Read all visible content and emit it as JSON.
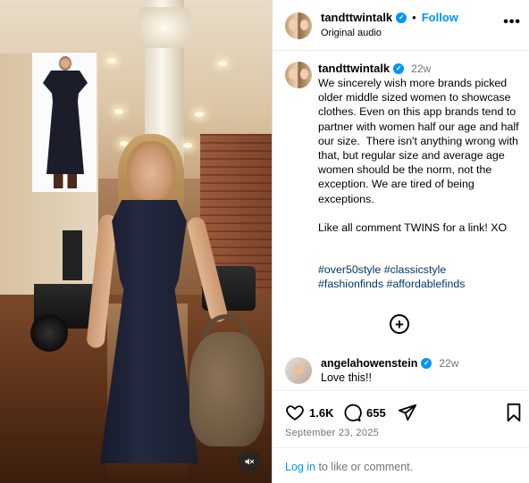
{
  "header": {
    "username": "tandttwintalk",
    "separator": "•",
    "follow_label": "Follow",
    "audio_label": "Original audio",
    "more_label": "•••"
  },
  "caption": {
    "username": "tandttwintalk",
    "time": "22w",
    "text": "We sincerely wish more brands picked older middle sized women to showcase clothes. Even on this app brands tend to partner with women half our age and half our size.  There isn't anything wrong with that, but regular size and average age women should be the norm, not the exception. We are tired of being exceptions.\n\nLike all comment TWINS for a link! XO",
    "hashtags": [
      "#over50style",
      "#classicstyle",
      "#fashionfinds",
      "#affordablefinds"
    ]
  },
  "load_more_icon": "plus-circle-icon",
  "comment": {
    "username": "angelahowenstein",
    "time": "22w",
    "text": "Love this!!"
  },
  "actions": {
    "likes": "1.6K",
    "comments": "655",
    "date": "September 23, 2025"
  },
  "login": {
    "link": "Log in",
    "rest": " to like or comment."
  },
  "media": {
    "mute_icon": "speaker-muted-icon"
  },
  "colors": {
    "accent": "#0095f6",
    "hashtag": "#00376b",
    "muted_text": "#737373"
  }
}
